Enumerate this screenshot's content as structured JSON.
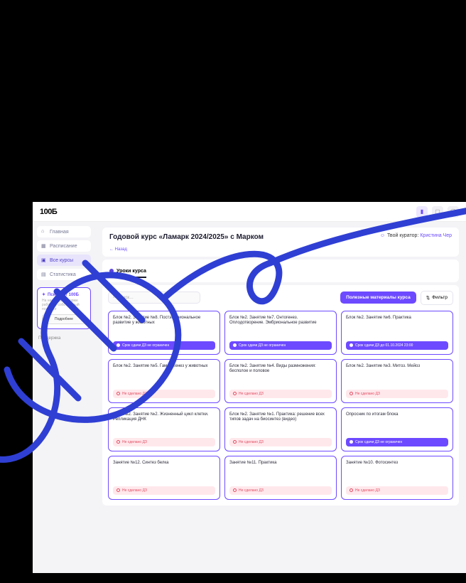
{
  "logo": "100Б",
  "sidebar": {
    "items": [
      {
        "label": "Главная",
        "active": false
      },
      {
        "label": "Расписание",
        "active": false
      },
      {
        "label": "Все курсы",
        "active": true
      },
      {
        "label": "Статистика",
        "active": false
      }
    ],
    "psych": {
      "title": "Психолог 100Б",
      "sub": "На нашей платформе работает собственный психолог",
      "button": "Подробнее"
    },
    "support": "Поддержка"
  },
  "header": {
    "title": "Годовой курс «Ламарк 2024/2025» с Марком",
    "back": "← Назад",
    "curator_label": "Твой куратор:",
    "curator_name": "Кристина Чер"
  },
  "tab": "Уроки курса",
  "toolbar": {
    "search_placeholder": "Поиск…",
    "materials": "Полезные материалы курса",
    "filter": "Фильтр"
  },
  "badges": {
    "unlimited": "Срок сдачи ДЗ не ограничен",
    "deadline": "Срок сдачи ДЗ до 01.10.2024 23:00",
    "notdone": "Не сделано ДЗ"
  },
  "cards": [
    {
      "title": "Блок №2. Занятие №8. Постэмбриональное развитие у животных",
      "badge": "unlimited",
      "style": "purple"
    },
    {
      "title": "Блок №2. Занятие №7. Онтогенез. Оплодотворение. Эмбриональное развитие",
      "badge": "unlimited",
      "style": "purple"
    },
    {
      "title": "Блок №2. Занятие №6. Практика",
      "badge": "deadline",
      "style": "purple"
    },
    {
      "title": "Блок №2. Занятие №5. Гаметогенез у животных",
      "badge": "notdone",
      "style": "red"
    },
    {
      "title": "Блок №2. Занятие №4. Виды размножения: бесполое и половое",
      "badge": "notdone",
      "style": "red"
    },
    {
      "title": "Блок №2. Занятие №3. Митоз. Мейоз",
      "badge": "notdone",
      "style": "red"
    },
    {
      "title": "Блок №2. Занятие №2. Жизненный цикл клетки. Репликация ДНК",
      "badge": "notdone",
      "style": "red"
    },
    {
      "title": "Блок №2. Занятие №1. Практика: решение всех типов задач на биосинтез (видео)",
      "badge": "notdone",
      "style": "red"
    },
    {
      "title": "Опросник по итогам блока",
      "badge": "unlimited",
      "style": "purple"
    },
    {
      "title": "Занятие №12. Синтез белка",
      "badge": "notdone",
      "style": "red"
    },
    {
      "title": "Занятие №11. Практика",
      "badge": "notdone",
      "style": "red"
    },
    {
      "title": "Занятие №10. Фотосинтез",
      "badge": "notdone",
      "style": "red"
    }
  ]
}
